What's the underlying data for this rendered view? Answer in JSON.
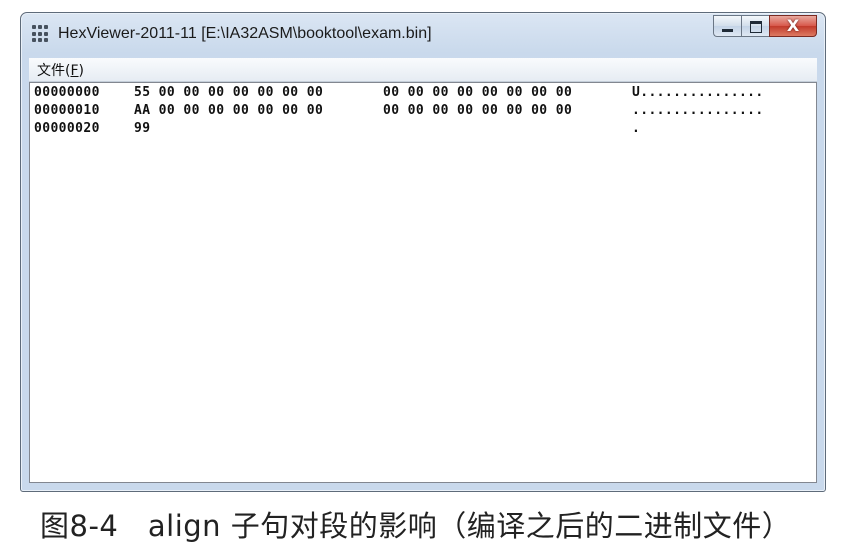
{
  "window": {
    "title": "HexViewer-2011-11 [E:\\IA32ASM\\booktool\\exam.bin]",
    "icon": "hex-grid-icon",
    "controls": {
      "minimize_icon": "minimize-icon",
      "maximize_icon": "maximize-icon",
      "close_icon": "close-icon",
      "close_glyph": "X"
    }
  },
  "menu": {
    "file_label_prefix": "文件(",
    "file_label_accel": "F",
    "file_label_suffix": ")"
  },
  "hex_rows": [
    {
      "offset": "00000000",
      "bytes1": "55 00 00 00 00 00 00 00",
      "bytes2": "00 00 00 00 00 00 00 00",
      "ascii": "U..............."
    },
    {
      "offset": "00000010",
      "bytes1": "AA 00 00 00 00 00 00 00",
      "bytes2": "00 00 00 00 00 00 00 00",
      "ascii": "................"
    },
    {
      "offset": "00000020",
      "bytes1": "99",
      "bytes2": "",
      "ascii": "."
    }
  ],
  "caption": "图8-4　align 子句对段的影响（编译之后的二进制文件）",
  "colors": {
    "titlebar": "#c9d9ec",
    "close_button": "#c23a2b",
    "text": "#111111"
  }
}
